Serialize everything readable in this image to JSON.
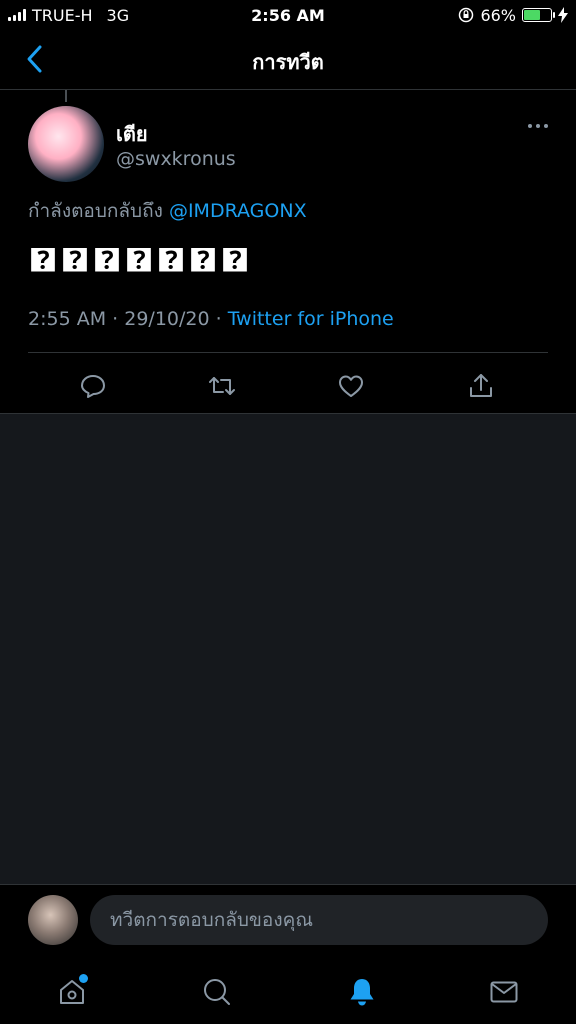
{
  "status_bar": {
    "carrier": "TRUE-H",
    "network": "3G",
    "time": "2:56 AM",
    "battery_percent": "66%",
    "battery_level": 0.66
  },
  "nav": {
    "title": "การทวีต"
  },
  "tweet": {
    "author_name": "เตีย",
    "author_handle": "@swxkronus",
    "reply_prefix": "กำลังตอบกลับถึง",
    "reply_mention": "@IMDRAGONX",
    "text": "🯄🯄🯄🯄🯄🯄🯄",
    "time": "2:55 AM",
    "date": "29/10/20",
    "separator": " · ",
    "source": "Twitter for iPhone"
  },
  "reply_bar": {
    "placeholder": "ทวีตการตอบกลับของคุณ"
  },
  "icons": {
    "back": "chevron-left-icon",
    "more": "more-horizontal-icon",
    "reply": "comment-icon",
    "retweet": "retweet-icon",
    "like": "heart-icon",
    "share": "share-icon",
    "home": "home-icon",
    "search": "search-icon",
    "notifications": "bell-icon",
    "messages": "mail-icon"
  },
  "colors": {
    "accent": "#1da1f2",
    "secondary_text": "#8b98a5",
    "background": "#000000",
    "divider": "#2f3336"
  }
}
